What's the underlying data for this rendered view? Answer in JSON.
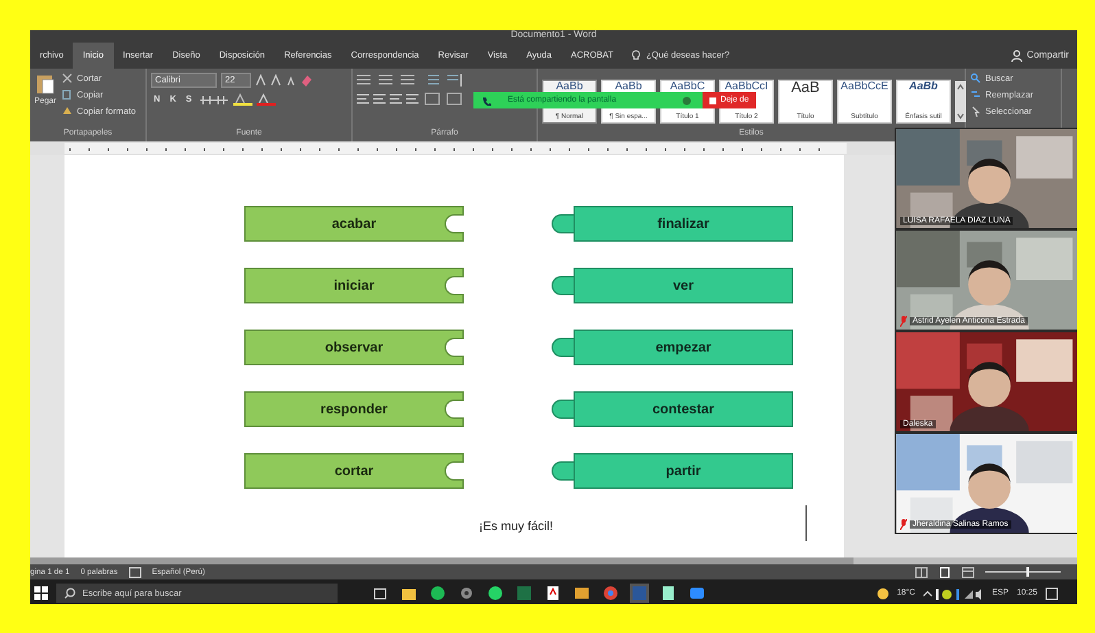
{
  "window": {
    "title": "Documento1 - Word"
  },
  "tabs": [
    {
      "label": "rchivo",
      "selected": false
    },
    {
      "label": "Inicio",
      "selected": true
    },
    {
      "label": "Insertar",
      "selected": false
    },
    {
      "label": "Diseño",
      "selected": false
    },
    {
      "label": "Disposición",
      "selected": false
    },
    {
      "label": "Referencias",
      "selected": false
    },
    {
      "label": "Correspondencia",
      "selected": false
    },
    {
      "label": "Revisar",
      "selected": false
    },
    {
      "label": "Vista",
      "selected": false
    },
    {
      "label": "Ayuda",
      "selected": false
    },
    {
      "label": "ACROBAT",
      "selected": false
    }
  ],
  "tell_me": {
    "placeholder": "¿Qué deseas hacer?"
  },
  "share": "Compartir",
  "ribbon": {
    "clipboard": {
      "paste": "Pegar",
      "items": [
        "Cortar",
        "Copiar",
        "Copiar formato"
      ],
      "label": "Portapapeles"
    },
    "font": {
      "name": "Calibri",
      "size": "22",
      "format_buttons": [
        "N",
        "K",
        "S"
      ],
      "label": "Fuente"
    },
    "paragraph": {
      "label": "Párrafo"
    },
    "styles": {
      "items": [
        {
          "sample": "AaBb",
          "name": "¶ Normal",
          "selected": true
        },
        {
          "sample": "AaBb",
          "name": "¶ Sin espa...",
          "selected": false
        },
        {
          "sample": "AaBbC",
          "name": "Título 1",
          "selected": false
        },
        {
          "sample": "AaBbCcI",
          "name": "Título 2",
          "selected": false
        },
        {
          "sample": "AaB",
          "name": "Título",
          "selected": false
        },
        {
          "sample": "AaBbCcE",
          "name": "Subtítulo",
          "selected": false
        },
        {
          "sample": "AaBb",
          "name": "Énfasis sutil",
          "selected": false
        }
      ],
      "label": "Estilos"
    },
    "editing": [
      "Buscar",
      "Reemplazar",
      "Seleccionar"
    ]
  },
  "share_banner": {
    "text": "Está compartiendo la pantalla",
    "stop_button": "Deje de"
  },
  "document": {
    "left_pieces": [
      "acabar",
      "iniciar",
      "observar",
      "responder",
      "cortar"
    ],
    "right_pieces": [
      "finalizar",
      "ver",
      "empezar",
      "contestar",
      "partir"
    ],
    "footer": "¡Es muy fácil!"
  },
  "participants": [
    {
      "name": "LUISA RAFAELA DIAZ LUNA",
      "muted": false
    },
    {
      "name": "Astrid Ayelen Anticona Estrada",
      "muted": true
    },
    {
      "name": "Daleska",
      "muted": false
    },
    {
      "name": "Jheraldina Salinas Ramos",
      "muted": true
    }
  ],
  "status_bar": {
    "page": "gina 1 de 1",
    "words": "0 palabras",
    "language": "Español (Perú)",
    "zoom": {
      "level": 0.55
    }
  },
  "taskbar": {
    "search": {
      "placeholder": "Escribe aquí para buscar"
    },
    "weather": "18°C",
    "input_language": "ESP",
    "time": "10:25"
  }
}
